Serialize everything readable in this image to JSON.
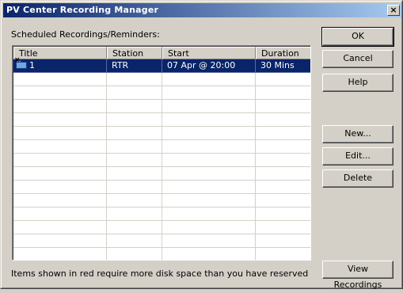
{
  "window": {
    "title": "PV Center Recording Manager",
    "close_glyph": "×"
  },
  "list": {
    "label": "Scheduled Recordings/Reminders:",
    "columns": [
      "Title",
      "Station",
      "Start",
      "Duration"
    ],
    "rows": [
      {
        "title": "1",
        "station": "RTR",
        "start": "07 Apr @ 20:00",
        "duration": "30 Mins",
        "icon": "folder-icon",
        "selected": true
      }
    ]
  },
  "buttons": {
    "ok": "OK",
    "cancel": "Cancel",
    "help": "Help",
    "new": "New...",
    "edit": "Edit...",
    "delete": "Delete",
    "view_recordings": "View Recordings"
  },
  "footer_note": "Items shown in red require more disk space than you have reserved",
  "colors": {
    "title_start": "#0a246a",
    "title_end": "#a6caf0",
    "selection": "#0a246a",
    "face": "#d4d0c8"
  }
}
